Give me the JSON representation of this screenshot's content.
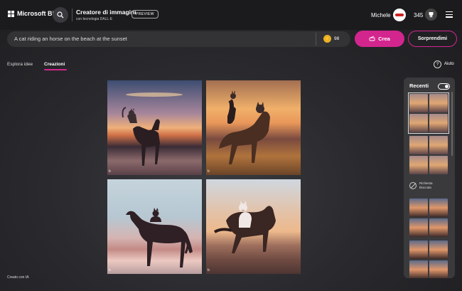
{
  "header": {
    "brand": "Microsoft Bing",
    "app_title": "Creatore di immagini",
    "app_subtitle": "con tecnologia DALL·E",
    "preview_badge": "PREVIEW",
    "user_name": "Michele",
    "reward_points": "345",
    "icons": [
      "windows-logo-icon",
      "search-icon",
      "trophy-icon",
      "hamburger-menu-icon"
    ]
  },
  "prompt": {
    "value": "A cat riding an horse on the beach at the sunset",
    "boost_count": "98",
    "create_label": "Crea",
    "surprise_label": "Sorprendimi"
  },
  "tabs": [
    {
      "label": "Esplora idee",
      "active": false
    },
    {
      "label": "Creazioni",
      "active": true
    }
  ],
  "help_label": "Aiuto",
  "gallery": {
    "images": [
      {
        "description": "cat riding horse on beach at sunset 1"
      },
      {
        "description": "cat riding horse on beach at sunset 2"
      },
      {
        "description": "cat riding horse on beach at sunset 3"
      },
      {
        "description": "cat riding horse on beach at sunset 4"
      }
    ],
    "ai_label": "Creato con IA"
  },
  "recent_panel": {
    "title": "Recenti",
    "toggle_on": true,
    "blocked_text": "Richiesta bloccata"
  },
  "colors": {
    "accent": "#d3258e",
    "topbar": "#1b1b1e",
    "coin": "#e9b026"
  }
}
